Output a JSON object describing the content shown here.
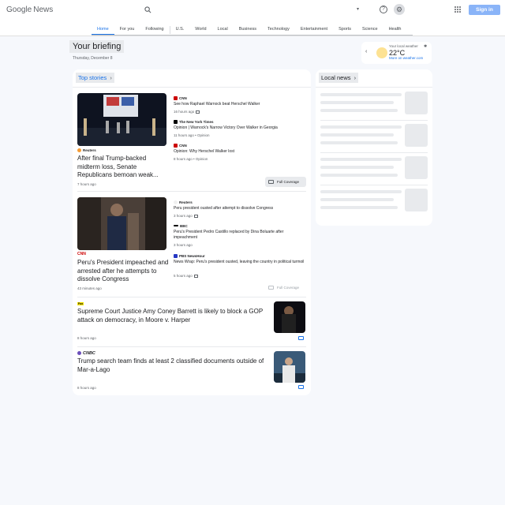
{
  "header": {
    "logo_google": "Google",
    "logo_news": "News",
    "search_placeholder": "",
    "signin_label": "Sign in"
  },
  "nav": {
    "tabs": [
      "Home",
      "For you",
      "Following",
      "U.S.",
      "World",
      "Local",
      "Business",
      "Technology",
      "Entertainment",
      "Sports",
      "Science",
      "Health"
    ],
    "active": "Home"
  },
  "briefing": {
    "title": "Your briefing",
    "date": "Thursday, December 8"
  },
  "weather": {
    "label": "Your local weather",
    "temp": "22°C",
    "link": "More on weather.com"
  },
  "top_stories": {
    "heading": "Top stories",
    "full_coverage": "Full Coverage",
    "clusters": [
      {
        "main": {
          "publisher": "Reuters",
          "title": "After final Trump-backed midterm loss, Senate Republicans bemoan weak...",
          "time": "7 hours ago"
        },
        "related": [
          {
            "publisher": "CNN",
            "title": "See how Raphael Warnock beat Herschel Walker",
            "time": "16 hours ago"
          },
          {
            "publisher": "The New York Times",
            "title": "Opinion | Warnock's Narrow Victory Over Walker in Georgia",
            "time": "11 hours ago • Opinion"
          },
          {
            "publisher": "CNN",
            "title": "Opinion: Why Herschel Walker lost",
            "time": "8 hours ago • Opinion"
          }
        ]
      },
      {
        "main": {
          "publisher": "CNN",
          "title": "Peru's President impeached and arrested after he attempts to dissolve Congress",
          "time": "43 minutes ago"
        },
        "related": [
          {
            "publisher": "Reuters",
            "title": "Peru president ousted after attempt to dissolve Congress",
            "time": "3 hours ago"
          },
          {
            "publisher": "BBC",
            "title": "Peru's President Pedro Castillo replaced by Dina Boluarte after impeachment",
            "time": "3 hours ago"
          },
          {
            "publisher": "PBS NewsHour",
            "title": "News Wrap: Peru's president ousted, leaving the country in political turmoil",
            "time": "5 hours ago"
          }
        ]
      }
    ],
    "singles": [
      {
        "publisher": "Fox",
        "title": "Supreme Court Justice Amy Coney Barrett is likely to block a GOP attack on democracy, in Moore v. Harper",
        "time": "8 hours ago"
      },
      {
        "publisher": "CNBC",
        "title": "Trump search team finds at least 2 classified documents outside of Mar-a-Lago",
        "time": "8 hours ago"
      }
    ]
  },
  "local_news": {
    "heading": "Local news"
  },
  "colors": {
    "accent": "#1a73e8",
    "page_bg": "#f6f8fc",
    "signin_bg": "#8ab4f8",
    "skeleton": "#e8eaed"
  },
  "icons": [
    "search-icon",
    "chevron-down-icon",
    "help-icon",
    "settings-icon",
    "apps-grid-icon",
    "sun-icon",
    "chevron-left-icon",
    "chevron-right-icon",
    "full-coverage-icon"
  ]
}
